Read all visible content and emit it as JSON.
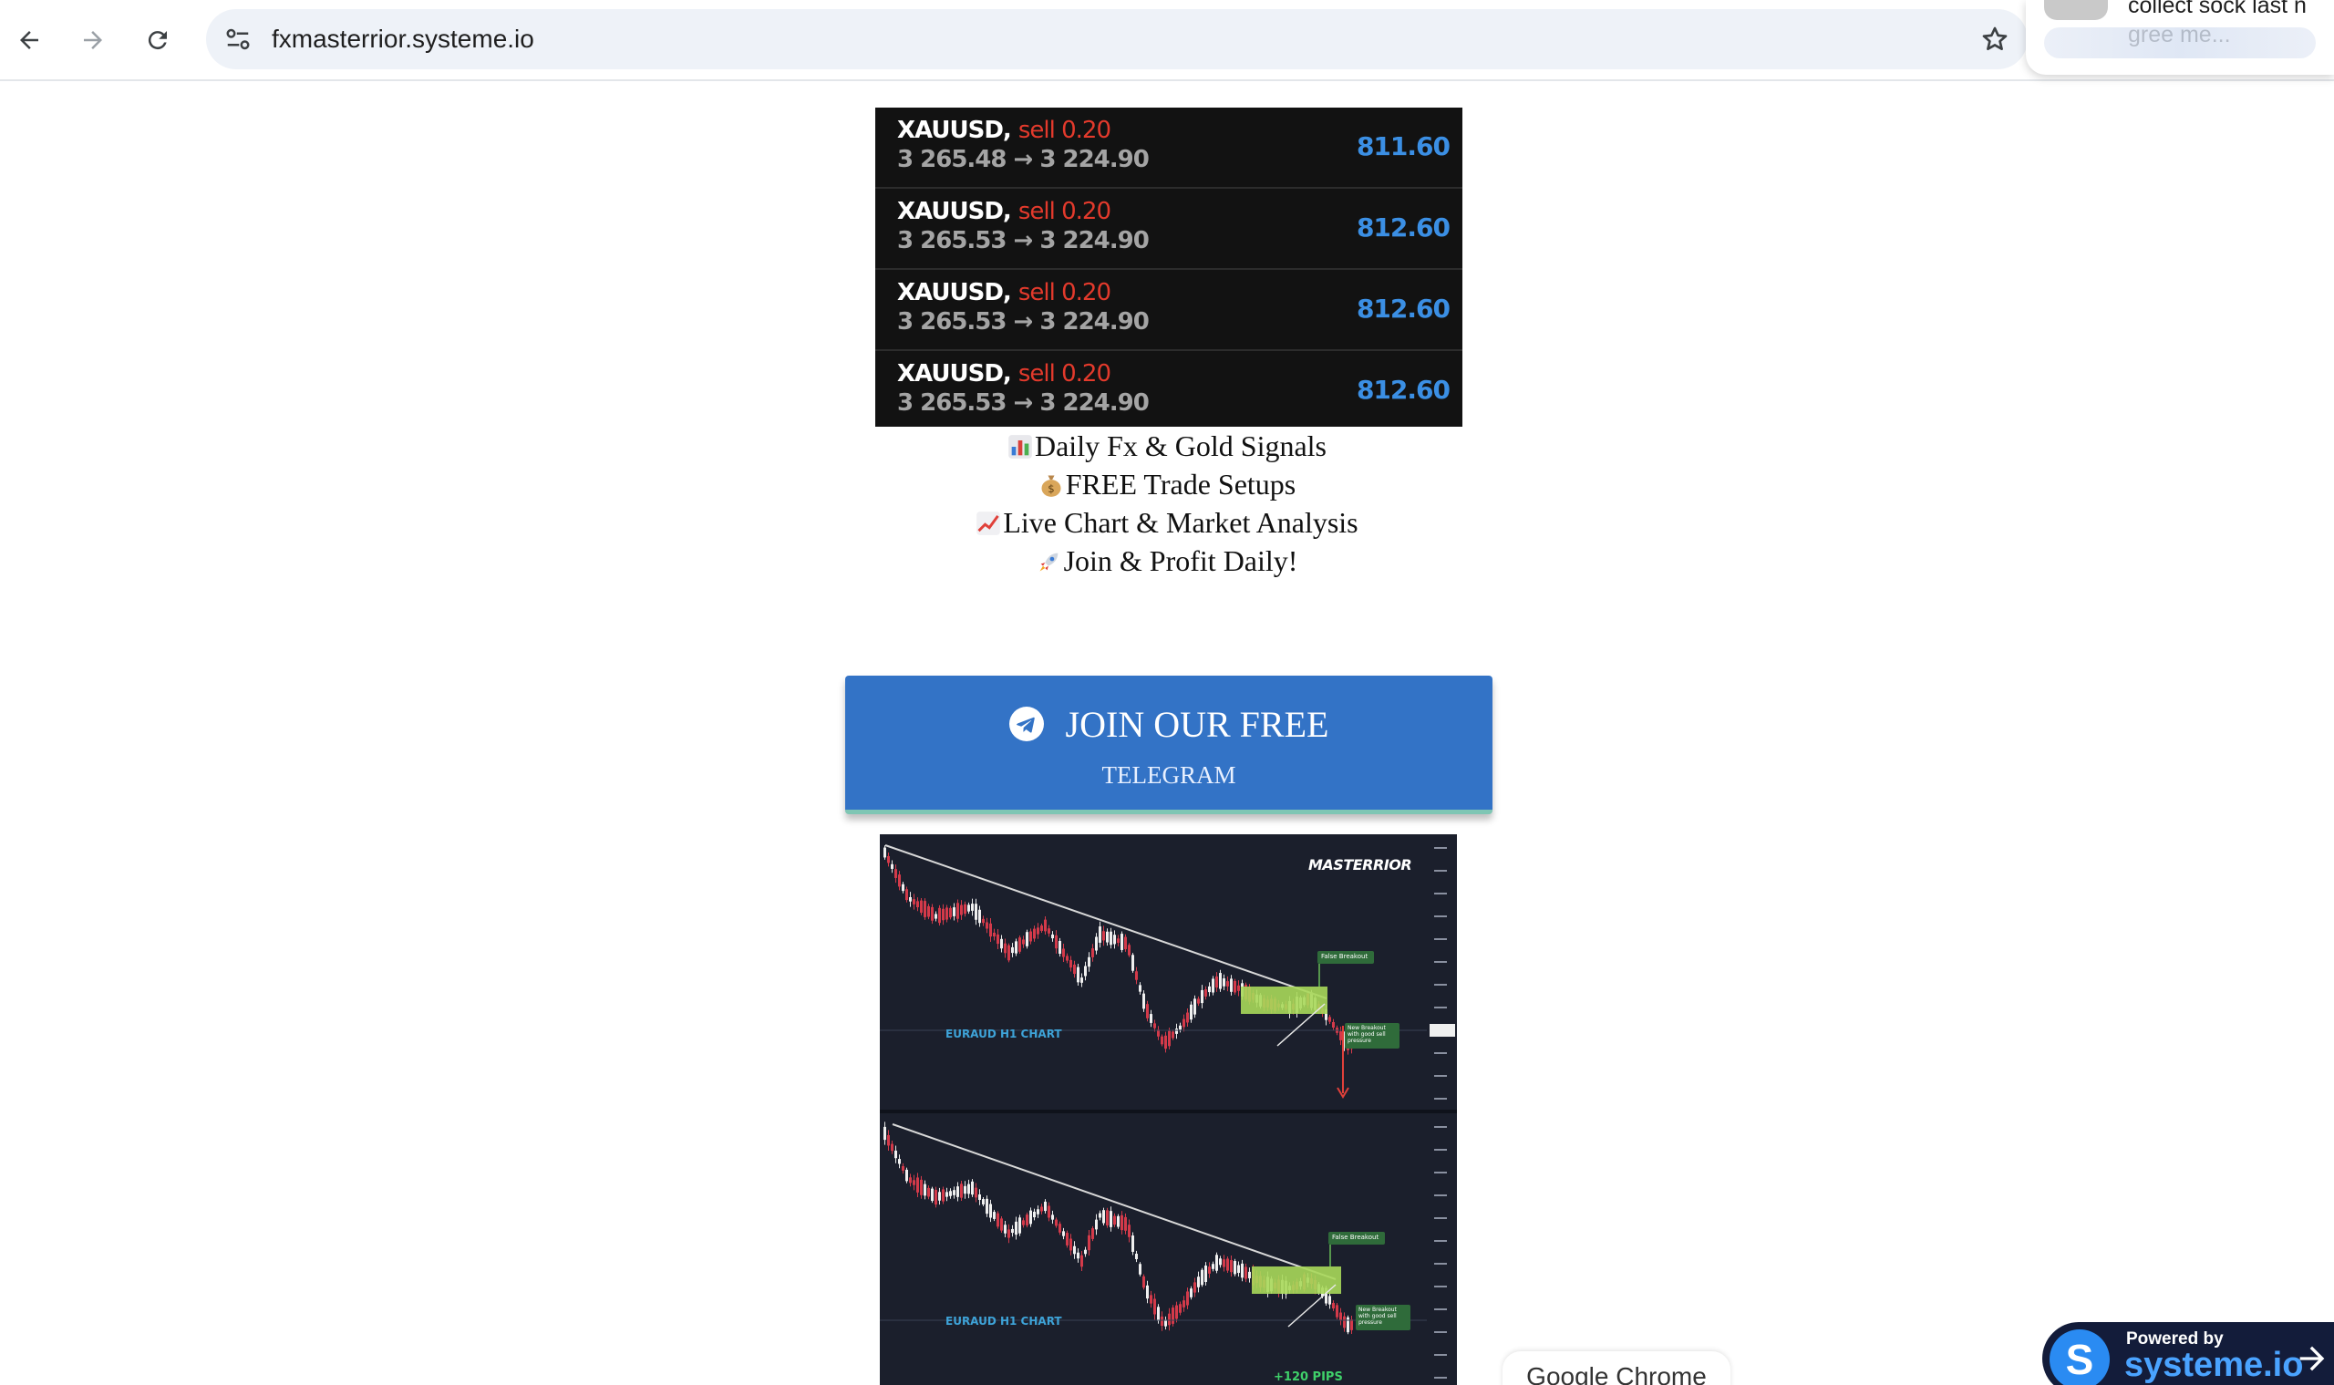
{
  "browser": {
    "url": "fxmasterrior.systeme.io"
  },
  "notification": {
    "line1": "collect sock last n",
    "line2": "gree me..."
  },
  "trades": [
    {
      "symbol": "XAUUSD,",
      "side": "sell 0.20",
      "prices": "3 265.48 → 3 224.90",
      "profit": "811.60"
    },
    {
      "symbol": "XAUUSD,",
      "side": "sell 0.20",
      "prices": "3 265.53 → 3 224.90",
      "profit": "812.60"
    },
    {
      "symbol": "XAUUSD,",
      "side": "sell 0.20",
      "prices": "3 265.53 → 3 224.90",
      "profit": "812.60"
    },
    {
      "symbol": "XAUUSD,",
      "side": "sell 0.20",
      "prices": "3 265.53 → 3 224.90",
      "profit": "812.60"
    }
  ],
  "features": [
    {
      "icon": "bar-chart-emoji",
      "text": "Daily Fx & Gold Signals"
    },
    {
      "icon": "money-bag-emoji",
      "text": "FREE Trade Setups"
    },
    {
      "icon": "chart-increasing-emoji",
      "text": "Live Chart & Market Analysis"
    },
    {
      "icon": "rocket-emoji",
      "text": "Join & Profit Daily!"
    }
  ],
  "cta": {
    "title": "JOIN OUR FREE",
    "subtitle": "TELEGRAM",
    "icon": "telegram-icon"
  },
  "chart_image": {
    "brand": "MASTERRIOR",
    "panel1_label": "EURAUD H1 CHART",
    "panel2_label": "EURAUD H1 CHART",
    "tag_false_breakout": "False Breakout",
    "tag_new_breakout": "New Breakout with good sell pressure",
    "pips": "+120 PIPS"
  },
  "chrome_bubble": "Google Chrome",
  "powered_by": {
    "label": "Powered by",
    "brand": "systeme.io"
  },
  "colors": {
    "cta_blue": "#3373c6",
    "sell_red": "#e33a2c",
    "profit_blue": "#3b8fe4",
    "chart_bg": "#1b1f2c",
    "zone_green": "#a8d85a"
  }
}
